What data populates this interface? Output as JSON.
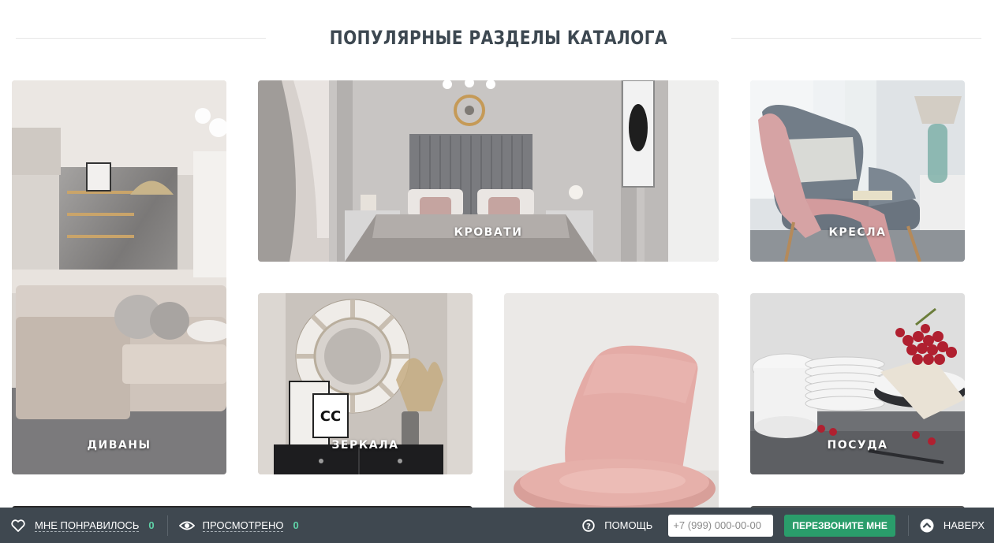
{
  "section": {
    "title": "ПОПУЛЯРНЫЕ РАЗДЕЛЫ КАТАЛОГА"
  },
  "catalog": {
    "tiles": [
      {
        "label": "ДИВАНЫ"
      },
      {
        "label": "КРОВАТИ"
      },
      {
        "label": "КРЕСЛА"
      },
      {
        "label": "ЗЕРКАЛА"
      },
      {
        "label": ""
      },
      {
        "label": "ПОСУДА"
      }
    ]
  },
  "bottom_bar": {
    "liked": {
      "label": "МНЕ ПОНРАВИЛОСЬ",
      "count": "0",
      "icon": "heart-icon"
    },
    "viewed": {
      "label": "ПРОСМОТРЕНО",
      "count": "0",
      "icon": "eye-icon"
    },
    "help": {
      "label": "ПОМОЩЬ",
      "icon": "question-circle-icon"
    },
    "phone": {
      "placeholder": "+7 (999) 000-00-00",
      "value": ""
    },
    "callback": {
      "label": "ПЕРЕЗВОНИТЕ МНЕ"
    },
    "to_top": {
      "label": "НАВЕРХ",
      "icon": "arrow-up-circle-icon"
    }
  },
  "colors": {
    "heading": "#3d4851",
    "bar_background": "#3f4850",
    "accent_green": "#2a9d6b",
    "count_color": "#5fd3a8"
  }
}
